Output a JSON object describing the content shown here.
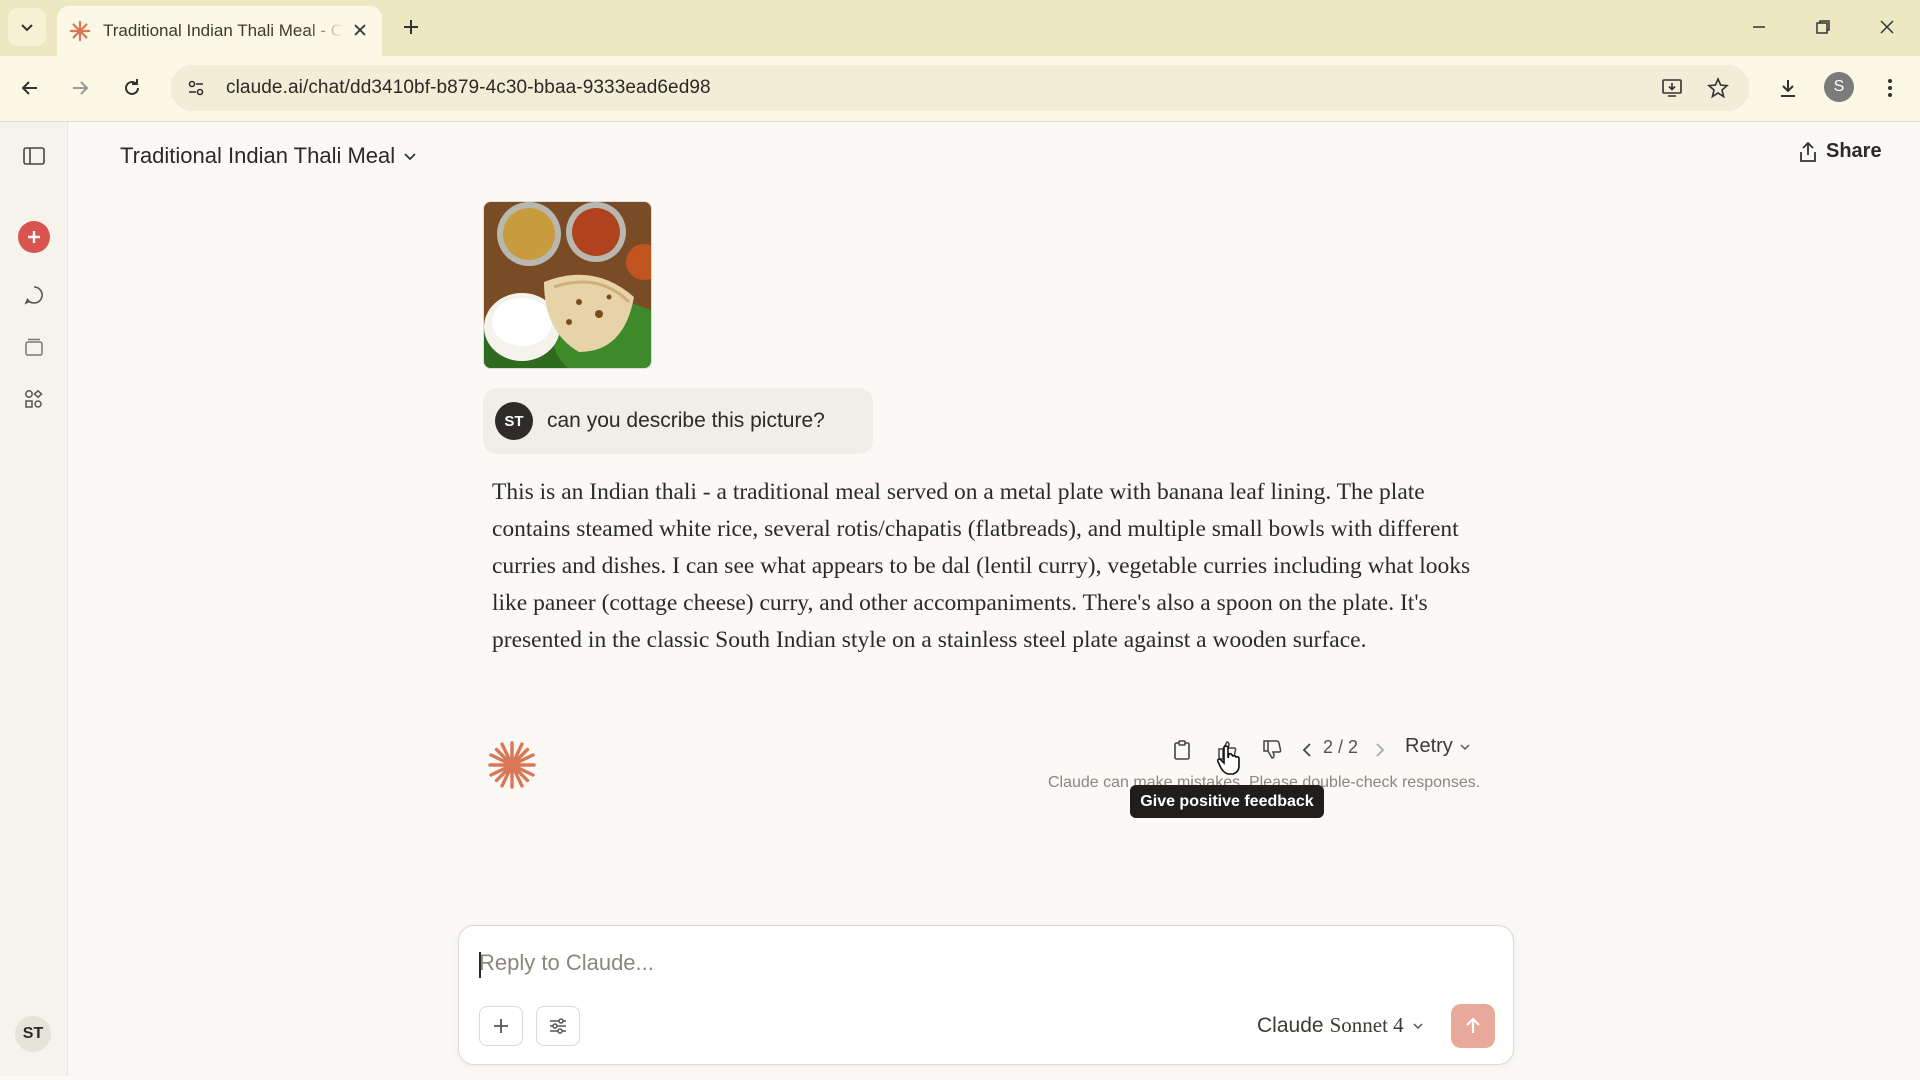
{
  "browser": {
    "tab_title": "Traditional Indian Thali Meal - Claude",
    "url": "claude.ai/chat/dd3410bf-b879-4c30-bbaa-9333ead6ed98",
    "profile_initial": "S"
  },
  "sidebar": {
    "user_initials": "ST",
    "items": [
      "new-chat",
      "chats",
      "projects",
      "artifacts"
    ]
  },
  "header": {
    "title": "Traditional Indian Thali Meal",
    "share_label": "Share"
  },
  "conversation": {
    "user_initials": "ST",
    "user_message": "can you describe this picture?",
    "assistant_message": "This is an Indian thali - a traditional meal served on a metal plate with banana leaf lining. The plate contains steamed white rice, several rotis/chapatis (flatbreads), and multiple small bowls with different curries and dishes. I can see what appears to be dal (lentil curry), vegetable curries including what looks like paneer (cottage cheese) curry, and other accompaniments. There's also a spoon on the plate. It's presented in the classic South Indian style on a stainless steel plate against a wooden surface.",
    "pager": "2 / 2",
    "retry_label": "Retry",
    "disclaimer": "Claude can make mistakes. Please double-check responses.",
    "tooltip": "Give positive feedback"
  },
  "composer": {
    "placeholder": "Reply to Claude...",
    "model_prefix": "Claude",
    "model_name": "Sonnet 4"
  },
  "colors": {
    "accent": "#d9534f",
    "claude_orange": "#d97757",
    "send_button": "#e8a99b",
    "background": "#faf9f5",
    "tabstrip": "#ede8c2"
  }
}
